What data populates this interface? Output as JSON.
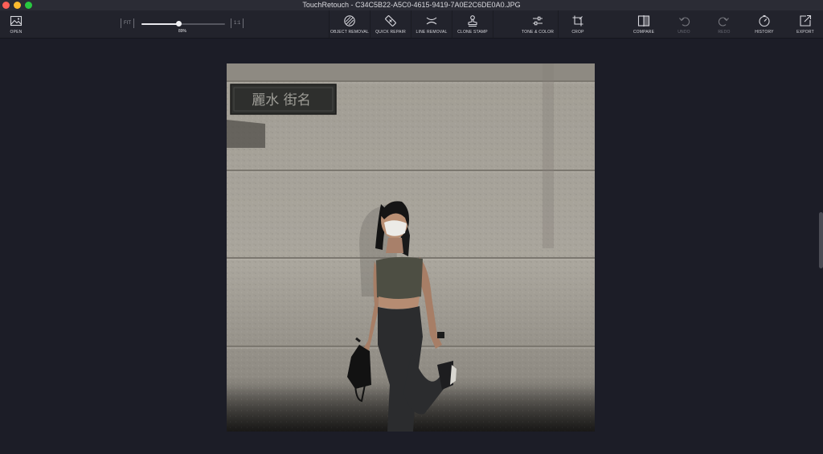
{
  "window": {
    "title": "TouchRetouch - C34C5B22-A5C0-4615-9419-7A0E2C6DE0A0.JPG"
  },
  "toolbar": {
    "open_label": "OPEN",
    "zoom": {
      "fit_label": "FIT",
      "one_to_one_label": "1:1",
      "value_text": "89%",
      "level": 0.45
    },
    "tools": [
      {
        "label": "OBJECT REMOVAL",
        "icon": "object-removal-icon"
      },
      {
        "label": "QUICK REPAIR",
        "icon": "quick-repair-icon"
      },
      {
        "label": "LINE REMOVAL",
        "icon": "line-removal-icon"
      },
      {
        "label": "CLONE STAMP",
        "icon": "clone-stamp-icon"
      },
      {
        "label": "TONE & COLOR",
        "icon": "tone-color-icon"
      },
      {
        "label": "CROP",
        "icon": "crop-icon"
      }
    ],
    "actions": [
      {
        "label": "COMPARE",
        "icon": "compare-icon",
        "enabled": true
      },
      {
        "label": "UNDO",
        "icon": "undo-icon",
        "enabled": false
      },
      {
        "label": "REDO",
        "icon": "redo-icon",
        "enabled": false
      },
      {
        "label": "HISTORY",
        "icon": "history-icon",
        "enabled": true
      },
      {
        "label": "EXPORT",
        "icon": "export-icon",
        "enabled": true
      }
    ]
  },
  "photo": {
    "sign_text": "麗水 街名"
  },
  "colors": {
    "background": "#1c1d27",
    "toolbar": "#22232c",
    "titlebar": "#2b2c35",
    "text": "#e6e6ea"
  }
}
